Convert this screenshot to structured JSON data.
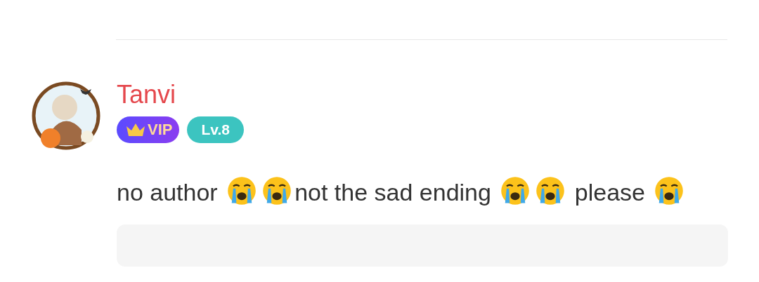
{
  "comment": {
    "user": {
      "name": "Tanvi",
      "vip_badge": "VIP",
      "level_badge": "Lv.8"
    },
    "body": [
      {
        "kind": "text",
        "text": "no author "
      },
      {
        "kind": "emoji"
      },
      {
        "kind": "emoji"
      },
      {
        "kind": "text",
        "text": "not the sad ending "
      },
      {
        "kind": "emoji"
      },
      {
        "kind": "emoji"
      },
      {
        "kind": "text",
        "text": " please "
      },
      {
        "kind": "emoji"
      }
    ]
  }
}
